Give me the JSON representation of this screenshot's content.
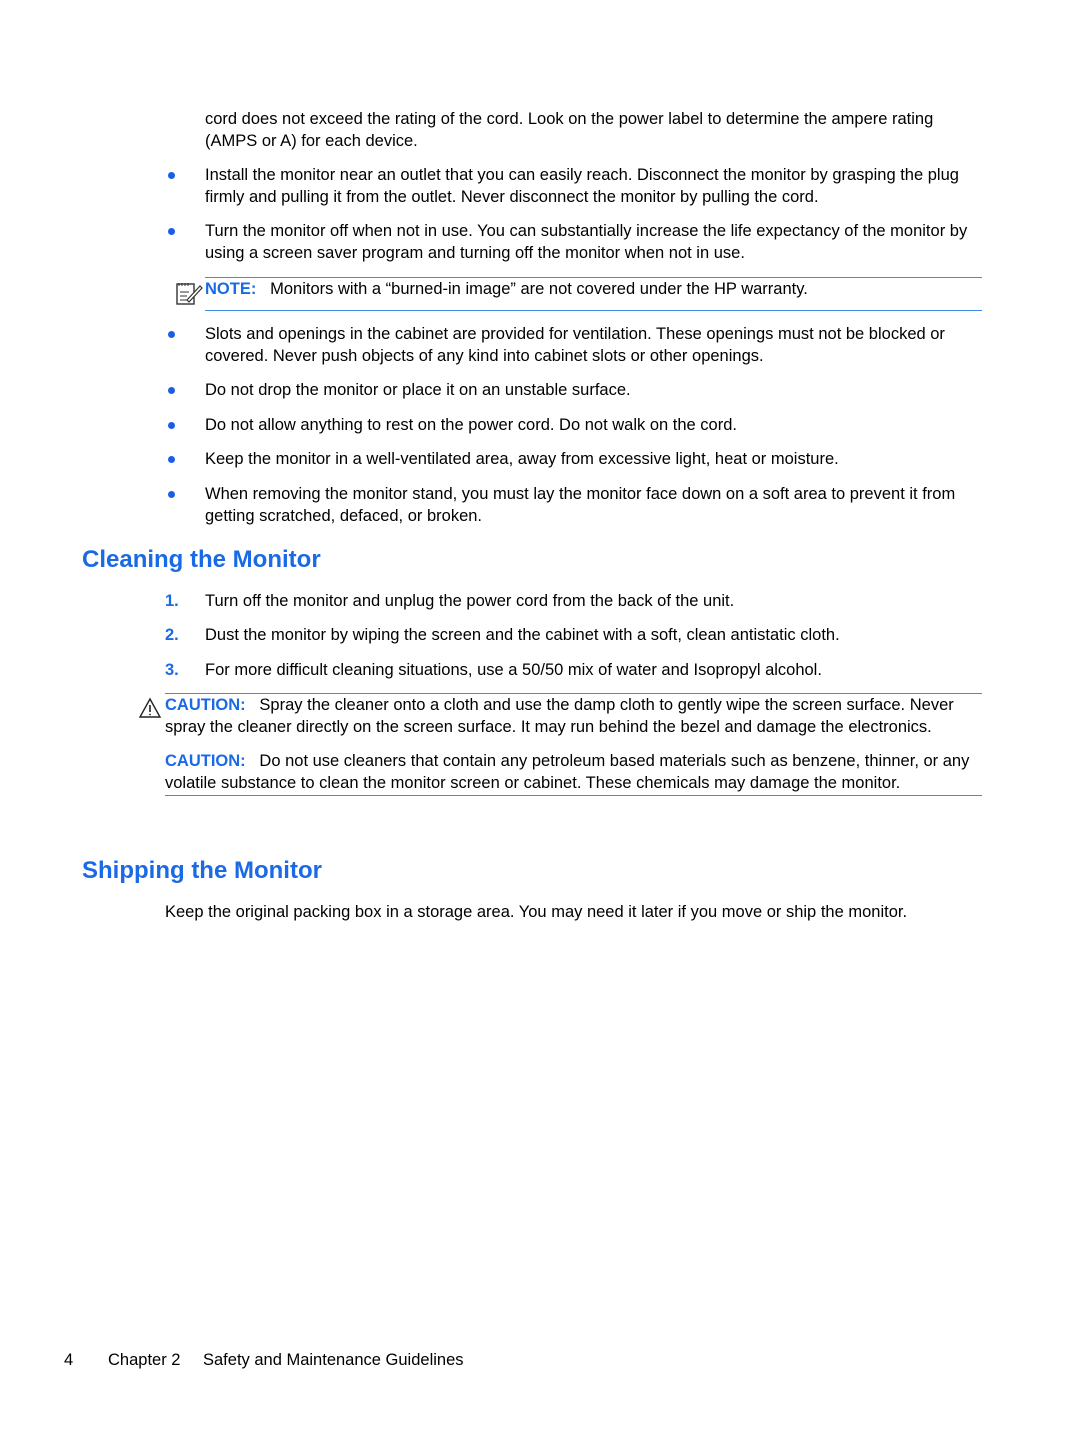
{
  "intro": {
    "continuation_text": "cord does not exceed the rating of the cord. Look on the power label to determine the ampere rating (AMPS or A) for each device."
  },
  "bullets_before_note": [
    {
      "text": "Install the monitor near an outlet that you can easily reach. Disconnect the monitor by grasping the plug firmly and pulling it from the outlet. Never disconnect the monitor by pulling the cord."
    },
    {
      "text": "Turn the monitor off when not in use. You can substantially increase the life expectancy of the monitor by using a screen saver program and turning off the monitor when not in use."
    }
  ],
  "note": {
    "icon": "note-pencil-icon",
    "label": "NOTE:",
    "text": "Monitors with a “burned-in image” are not covered under the HP warranty."
  },
  "bullets_after_note": [
    {
      "text": "Slots and openings in the cabinet are provided for ventilation. These openings must not be blocked or covered. Never push objects of any kind into cabinet slots or other openings."
    },
    {
      "text": "Do not drop the monitor or place it on an unstable surface."
    },
    {
      "text": "Do not allow anything to rest on the power cord. Do not walk on the cord."
    },
    {
      "text": "Keep the monitor in a well-ventilated area, away from excessive light, heat or moisture."
    },
    {
      "text": "When removing the monitor stand, you must lay the monitor face down on a soft area to prevent it from getting scratched, defaced, or broken."
    }
  ],
  "cleaning": {
    "heading": "Cleaning the Monitor",
    "steps": [
      {
        "num": "1.",
        "text": "Turn off the monitor and unplug the power cord from the back of the unit."
      },
      {
        "num": "2.",
        "text": "Dust the monitor by wiping the screen and the cabinet with a soft, clean antistatic cloth."
      },
      {
        "num": "3.",
        "text": "For more difficult cleaning situations, use a 50/50 mix of water and Isopropyl alcohol."
      }
    ],
    "cautions": [
      {
        "icon": "warning-triangle-icon",
        "label": "CAUTION:",
        "text": "Spray the cleaner onto a cloth and use the damp cloth to gently wipe the screen surface. Never spray the cleaner directly on the screen surface. It may run behind the bezel and damage the electronics."
      },
      {
        "label": "CAUTION:",
        "text": "Do not use cleaners that contain any petroleum based materials such as benzene, thinner, or any volatile substance to clean the monitor screen or cabinet. These chemicals may damage the monitor."
      }
    ]
  },
  "shipping": {
    "heading": "Shipping the Monitor",
    "text": "Keep the original packing box in a storage area. You may need it later if you move or ship the monitor."
  },
  "footer": {
    "page_number": "4",
    "chapter": "Chapter 2",
    "chapter_title": "Safety and Maintenance Guidelines"
  },
  "colors": {
    "accent": "#1a6ae6",
    "rule": "#3b8de8",
    "text": "#000000"
  }
}
